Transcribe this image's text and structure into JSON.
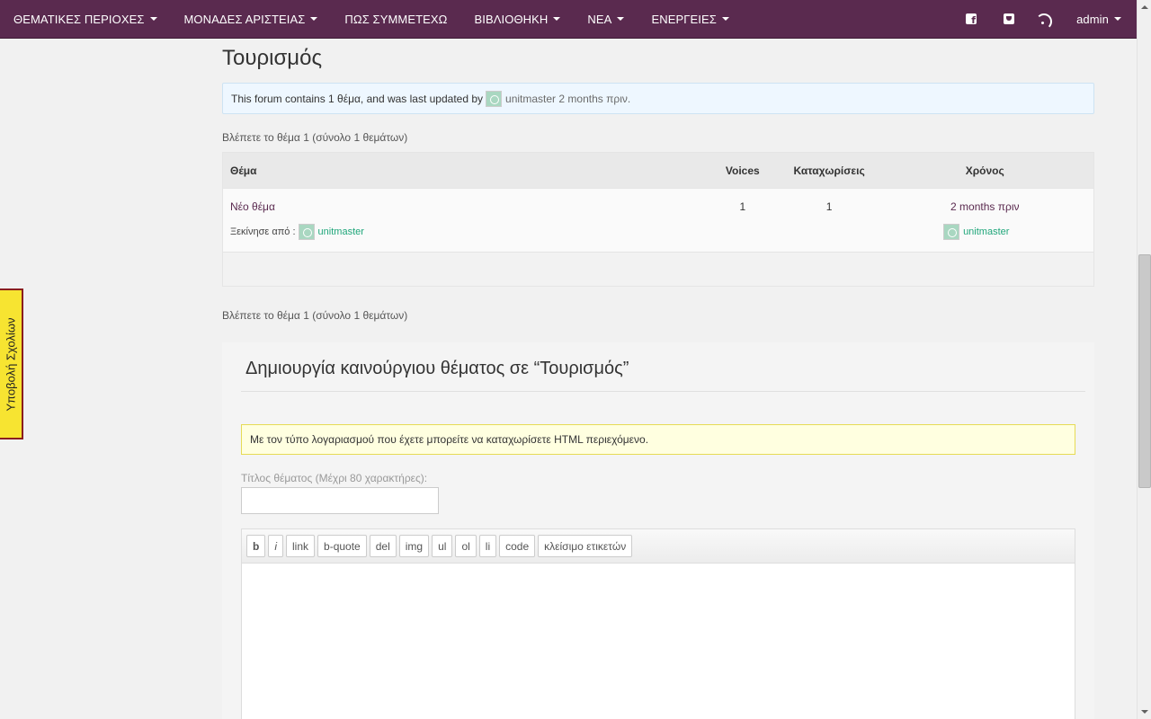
{
  "nav": {
    "items": [
      {
        "label": "ΘΕΜΑΤΙΚΕΣ ΠΕΡΙΟΧΕΣ"
      },
      {
        "label": "ΜΟΝΑΔΕΣ ΑΡΙΣΤΕΙΑΣ"
      },
      {
        "label": "ΠΩΣ ΣΥΜΜΕΤΕΧΩ"
      },
      {
        "label": "ΒΙΒΛΙΟΘΗΚΗ"
      },
      {
        "label": "ΝΕΑ"
      },
      {
        "label": "ΕΝΕΡΓΕΙΕΣ"
      }
    ],
    "admin_label": "admin",
    "icons": [
      "facebook-icon",
      "twitter-icon",
      "rss-icon"
    ]
  },
  "feedback_tab": {
    "label": "Υποβολή Σχολίων"
  },
  "forum": {
    "title": "Τουρισμός",
    "info": {
      "prefix": "This forum contains 1 θέμα, and was last updated by",
      "user": "unitmaster",
      "suffix": "2 months πριν."
    },
    "pagination_count": "Βλέπετε το θέμα 1 (σύνολο 1 θεμάτων)"
  },
  "table": {
    "headers": {
      "topic": "Θέμα",
      "voices": "Voices",
      "posts": "Καταχωρίσεις",
      "freshness": "Χρόνος"
    },
    "rows": [
      {
        "topic": "Νέο θέμα",
        "started_by_label": "Ξεκίνησε από :",
        "author": "unitmaster",
        "voices": "1",
        "posts": "1",
        "freshness": "2 months πριν",
        "last_author": "unitmaster"
      }
    ]
  },
  "new_topic": {
    "heading": "Δημιουργία καινούργιου θέματος σε “Τουρισμός”",
    "notice": "Με τον τύπο λογαριασμού που έχετε μπορείτε να καταχωρίσετε HTML περιεχόμενο.",
    "title_label": "Τίτλος θέματος (Μέχρι 80 χαρακτήρες):",
    "title_value": "",
    "toolbar": [
      "b",
      "i",
      "link",
      "b-quote",
      "del",
      "img",
      "ul",
      "ol",
      "li",
      "code",
      "κλείσιμο ετικετών"
    ]
  },
  "colors": {
    "navbar": "#5a2a4f",
    "link": "#5a2a4f",
    "author": "#1fa67a",
    "feedback": "#f7e431"
  }
}
